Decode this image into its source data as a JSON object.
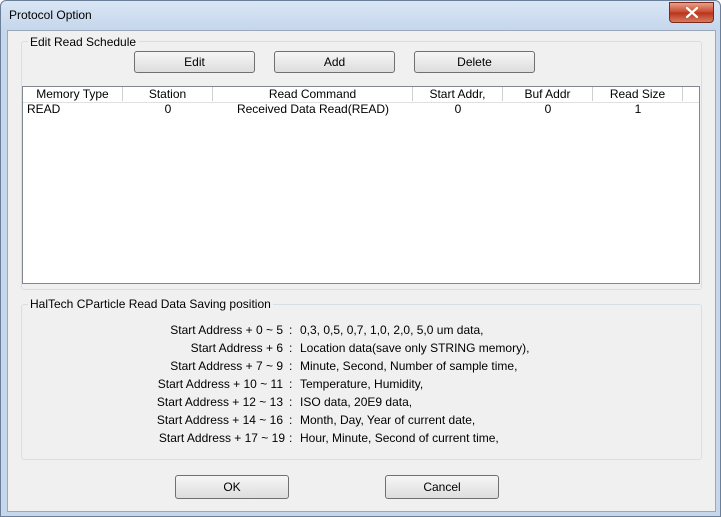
{
  "window": {
    "title": "Protocol Option"
  },
  "schedule": {
    "legend": "Edit Read Schedule",
    "buttons": {
      "edit": "Edit",
      "add": "Add",
      "delete": "Delete"
    },
    "columns": [
      "Memory Type",
      "Station",
      "Read Command",
      "Start Addr,",
      "Buf Addr",
      "Read Size"
    ],
    "rows": [
      [
        "READ",
        "0",
        "Received Data Read(READ)",
        "0",
        "0",
        "1"
      ]
    ]
  },
  "info": {
    "legend": "HalTech CParticle Read Data Saving position",
    "separator": ":",
    "lines": [
      {
        "key": "Start Address + 0 ~ 5",
        "value": "0,3, 0,5, 0,7, 1,0, 2,0, 5,0 um data,"
      },
      {
        "key": "Start Address + 6",
        "value": "Location data(save only STRING memory),"
      },
      {
        "key": "Start Address + 7 ~ 9",
        "value": "Minute, Second, Number of sample time,"
      },
      {
        "key": "Start Address + 10 ~ 11",
        "value": "Temperature, Humidity,"
      },
      {
        "key": "Start Address + 12 ~ 13",
        "value": "ISO data, 20E9 data,"
      },
      {
        "key": "Start Address + 14 ~ 16",
        "value": "Month, Day, Year of current date,"
      },
      {
        "key": "Start Address + 17 ~ 19",
        "value": "Hour, Minute, Second of current time,"
      }
    ]
  },
  "footer": {
    "ok": "OK",
    "cancel": "Cancel"
  }
}
